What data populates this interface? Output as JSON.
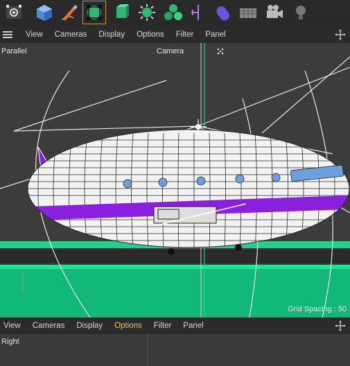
{
  "toolbar": {
    "icons": [
      "render-settings-icon",
      "cube-icon",
      "pen-icon",
      "subdivision-icon",
      "extrude-icon",
      "array-icon",
      "cloner-icon",
      "deformer-icon",
      "field-icon",
      "floor-icon",
      "camera-icon",
      "light-icon"
    ]
  },
  "top_menu": {
    "items": [
      "View",
      "Cameras",
      "Display",
      "Options",
      "Filter",
      "Panel"
    ]
  },
  "top_viewport": {
    "projection": "Parallel",
    "camera": "Camera",
    "grid_spacing": "Grid Spacing : 50"
  },
  "bottom_menu": {
    "items": [
      "View",
      "Cameras",
      "Display",
      "Options",
      "Filter",
      "Panel"
    ],
    "active": "Options"
  },
  "bottom_viewport": {
    "projection": "Right"
  },
  "colors": {
    "accent_menu": "#e8c55a",
    "menu_text": "#d6d6d6",
    "selection_green": "#1fd18b",
    "hull_stripe": "#8b1fe0",
    "viewport_bg": "#3c3c3c"
  }
}
